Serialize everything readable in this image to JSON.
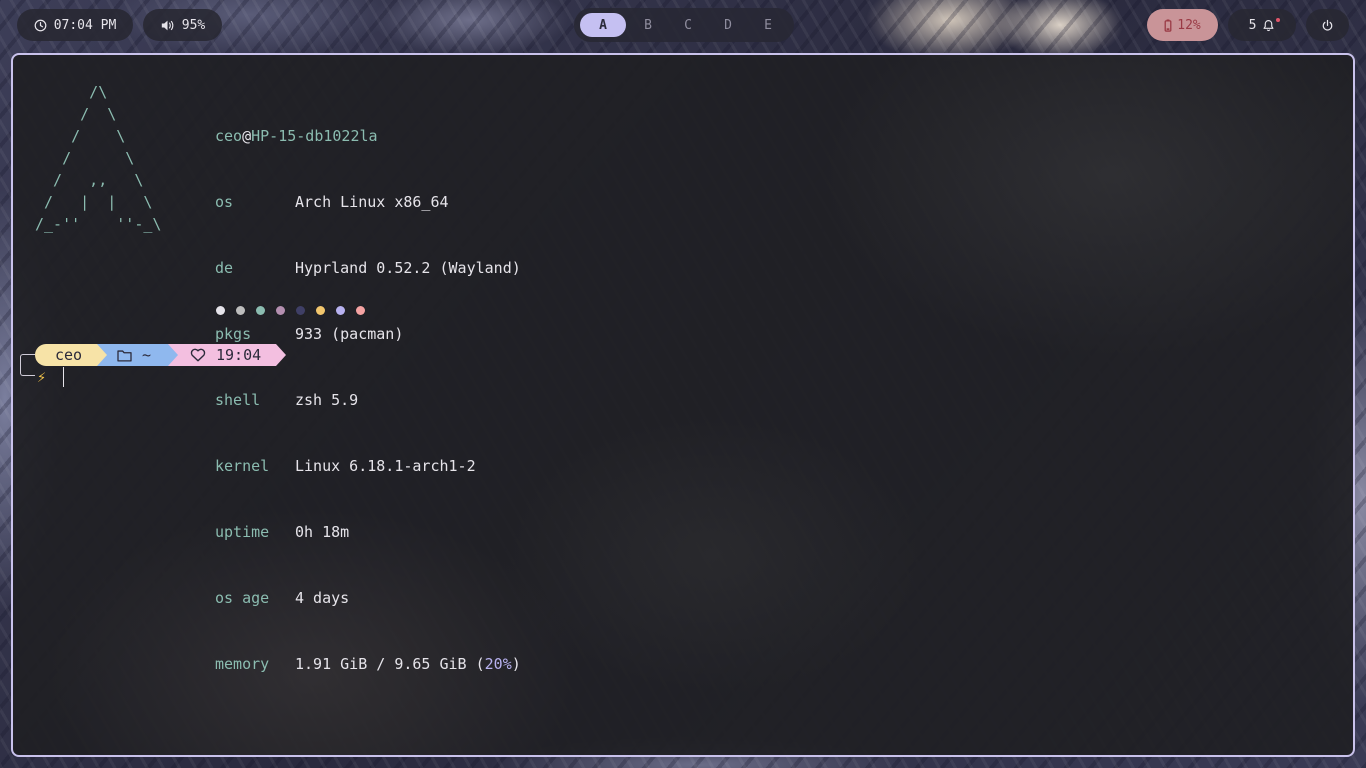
{
  "topbar": {
    "clock": "07:04 PM",
    "volume": "95%",
    "workspaces": [
      "A",
      "B",
      "C",
      "D",
      "E"
    ],
    "active_workspace": "A",
    "battery": "12%",
    "notifications": "5",
    "icons": {
      "clock": "clock-icon",
      "volume": "speaker-icon",
      "battery": "battery-low-icon",
      "bell": "bell-icon",
      "power": "power-icon"
    },
    "colors": {
      "battery_bg": "#c99498",
      "workspace_active": "#c5c0f2",
      "notification_dot": "#e0566a"
    }
  },
  "terminal": {
    "ascii_logo": "      /\\\n     /  \\\n    /    \\\n   /      \\\n  /   ,,   \\\n /   |  |   \\\n/_-''    ''-_\\",
    "user": "ceo",
    "at": "@",
    "host": "HP-15-db1022la",
    "fetch": [
      {
        "key": "os",
        "value": "Arch Linux x86_64"
      },
      {
        "key": "de",
        "value": "Hyprland 0.52.2 (Wayland)"
      },
      {
        "key": "pkgs",
        "value": "933 (pacman)"
      },
      {
        "key": "shell",
        "value": "zsh 5.9"
      },
      {
        "key": "kernel",
        "value": "Linux 6.18.1-arch1-2"
      },
      {
        "key": "uptime",
        "value": "0h 18m"
      },
      {
        "key": "os age",
        "value": "4 days"
      }
    ],
    "memory": {
      "key": "memory",
      "value_prefix": "1.91 GiB / 9.65 GiB (",
      "percent": "20%",
      "value_suffix": ")"
    },
    "palette": [
      "#e6e4ea",
      "#bdbdbd",
      "#8bbcb0",
      "#b48fb0",
      "#3f3f66",
      "#f2c66d",
      "#b8b2f0",
      "#f5a3a3"
    ],
    "prompt": {
      "user": "ceo",
      "dir": "~",
      "time": "19:04",
      "symbol": "⚡",
      "colors": {
        "user": "#f7e3a7",
        "dir": "#8fb8ee",
        "time": "#f3bfe0"
      }
    },
    "colors": {
      "accent": "#8bbcb0",
      "border": "#c9c2ec"
    }
  }
}
